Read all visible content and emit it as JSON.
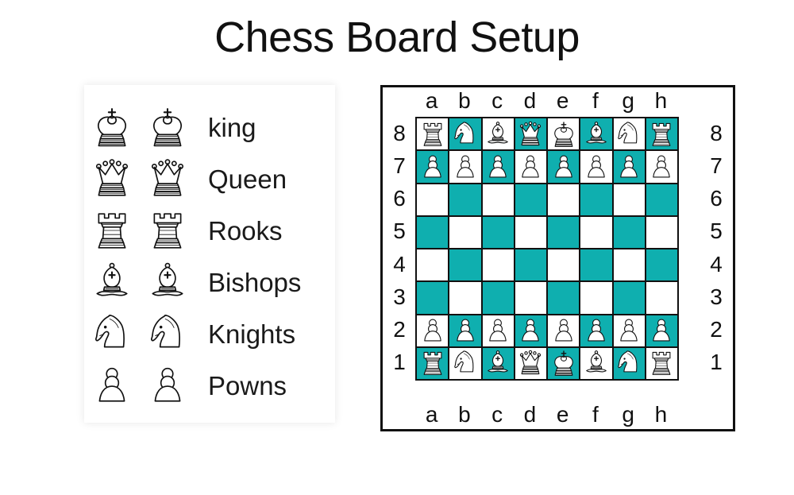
{
  "title": "Chess Board Setup",
  "colors": {
    "dark_square": "#0FAFAF",
    "light_square": "#ffffff",
    "border": "#111111",
    "text": "#111111"
  },
  "legend": {
    "rows": [
      {
        "label": "king",
        "black_icon": "king-black-icon",
        "white_icon": "king-white-icon"
      },
      {
        "label": "Queen",
        "black_icon": "queen-black-icon",
        "white_icon": "queen-white-icon"
      },
      {
        "label": "Rooks",
        "black_icon": "rook-black-icon",
        "white_icon": "rook-white-icon"
      },
      {
        "label": "Bishops",
        "black_icon": "bishop-black-icon",
        "white_icon": "bishop-white-icon"
      },
      {
        "label": "Knights",
        "black_icon": "knight-black-icon",
        "white_icon": "knight-white-icon"
      },
      {
        "label": "Powns",
        "black_icon": "pawn-black-icon",
        "white_icon": "pawn-white-icon"
      }
    ]
  },
  "board": {
    "files_top": [
      "a",
      "b",
      "c",
      "d",
      "e",
      "f",
      "g",
      "h"
    ],
    "files_bottom": [
      "a",
      "b",
      "c",
      "d",
      "e",
      "f",
      "g",
      "h"
    ],
    "ranks_left": [
      "8",
      "7",
      "6",
      "5",
      "4",
      "3",
      "2",
      "1"
    ],
    "ranks_right": [
      "8",
      "7",
      "6",
      "5",
      "4",
      "3",
      "2",
      "1"
    ],
    "position": [
      [
        "rook-black",
        "knight-black",
        "bishop-black",
        "queen-black",
        "king-black",
        "bishop-black",
        "knight-black",
        "rook-black"
      ],
      [
        "pawn-black",
        "pawn-black",
        "pawn-black",
        "pawn-black",
        "pawn-black",
        "pawn-black",
        "pawn-black",
        "pawn-black"
      ],
      [
        "",
        "",
        "",
        "",
        "",
        "",
        "",
        ""
      ],
      [
        "",
        "",
        "",
        "",
        "",
        "",
        "",
        ""
      ],
      [
        "",
        "",
        "",
        "",
        "",
        "",
        "",
        ""
      ],
      [
        "",
        "",
        "",
        "",
        "",
        "",
        "",
        ""
      ],
      [
        "pawn-white",
        "pawn-white",
        "pawn-white",
        "pawn-white",
        "pawn-white",
        "pawn-white",
        "pawn-white",
        "pawn-white"
      ],
      [
        "rook-white",
        "knight-white",
        "bishop-white",
        "queen-white",
        "king-white",
        "bishop-white",
        "knight-white",
        "rook-white"
      ]
    ],
    "square_colors": [
      [
        "light",
        "dark",
        "light",
        "dark",
        "light",
        "dark",
        "light",
        "dark"
      ],
      [
        "dark",
        "light",
        "dark",
        "light",
        "dark",
        "light",
        "dark",
        "light"
      ],
      [
        "light",
        "dark",
        "light",
        "dark",
        "light",
        "dark",
        "light",
        "dark"
      ],
      [
        "dark",
        "light",
        "dark",
        "light",
        "dark",
        "light",
        "dark",
        "light"
      ],
      [
        "light",
        "dark",
        "light",
        "dark",
        "light",
        "dark",
        "light",
        "dark"
      ],
      [
        "dark",
        "light",
        "dark",
        "light",
        "dark",
        "light",
        "dark",
        "light"
      ],
      [
        "light",
        "dark",
        "light",
        "dark",
        "light",
        "dark",
        "light",
        "dark"
      ],
      [
        "dark",
        "light",
        "dark",
        "light",
        "dark",
        "light",
        "dark",
        "light"
      ]
    ]
  }
}
